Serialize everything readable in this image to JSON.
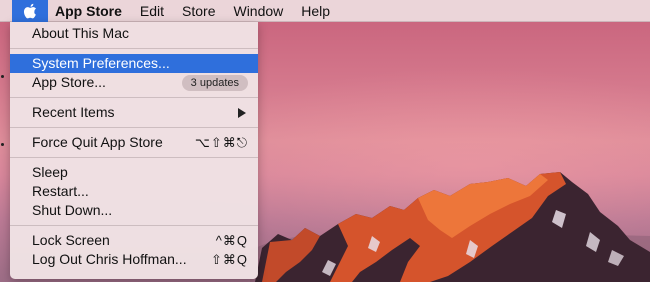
{
  "menubar": {
    "apple_icon": "apple-logo-icon",
    "app_name": "App Store",
    "items": [
      "Edit",
      "Store",
      "Window",
      "Help"
    ]
  },
  "apple_menu": {
    "about": "About This Mac",
    "system_preferences": "System Preferences...",
    "app_store": "App Store...",
    "app_store_badge": "3 updates",
    "recent_items": "Recent Items",
    "force_quit": "Force Quit App Store",
    "force_quit_shortcut": "⌥⇧⌘⎋",
    "sleep": "Sleep",
    "restart": "Restart...",
    "shut_down": "Shut Down...",
    "lock_screen": "Lock Screen",
    "lock_screen_shortcut": "^⌘Q",
    "log_out": "Log Out Chris Hoffman...",
    "log_out_shortcut": "⇧⌘Q"
  },
  "colors": {
    "highlight": "#2f6fdc",
    "menu_background": "#f0e2e4",
    "wallpaper_sky": "#d4788c",
    "mountain_glow": "#e0552e"
  }
}
